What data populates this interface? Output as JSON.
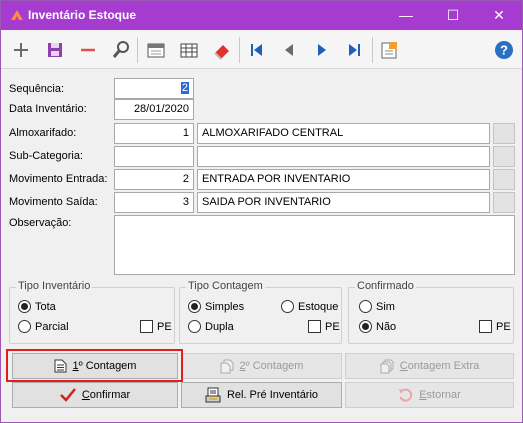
{
  "window": {
    "title": "Inventário Estoque",
    "minimize": "—",
    "maximize": "☐",
    "close": "✕"
  },
  "toolbar": {
    "icons": [
      "add-icon",
      "save-icon",
      "remove-icon",
      "search-icon",
      "export-icon",
      "grid-icon",
      "eraser-icon",
      "first-icon",
      "prev-icon",
      "next-icon",
      "last-icon",
      "report-icon",
      "help-icon"
    ]
  },
  "form": {
    "sequencia": {
      "label": "Sequência:",
      "value": "2"
    },
    "data_inventario": {
      "label": "Data Inventário:",
      "value": "28/01/2020"
    },
    "almoxarifado": {
      "label": "Almoxarifado:",
      "code": "1",
      "desc": "ALMOXARIFADO CENTRAL"
    },
    "subcategoria": {
      "label": "Sub-Categoria:",
      "code": "",
      "desc": ""
    },
    "mov_entrada": {
      "label": "Movimento Entrada:",
      "code": "2",
      "desc": "ENTRADA POR INVENTARIO"
    },
    "mov_saida": {
      "label": "Movimento Saída:",
      "code": "3",
      "desc": "SAIDA POR INVENTARIO"
    },
    "observacao": {
      "label": "Observação:",
      "value": ""
    }
  },
  "groups": {
    "tipo_inventario": {
      "title": "Tipo Inventário",
      "opt1": "Tota",
      "opt2": "Parcial",
      "pe": "PE",
      "selected": "Tota"
    },
    "tipo_contagem": {
      "title": "Tipo Contagem",
      "opt1": "Simples",
      "opt2": "Dupla",
      "opt3": "Estoque",
      "pe": "PE",
      "selected": "Simples"
    },
    "confirmado": {
      "title": "Confirmado",
      "opt1": "Sim",
      "opt2": "Não",
      "pe": "PE",
      "selected": "Não"
    }
  },
  "buttons": {
    "contagem1": {
      "mn": "1",
      "rest": "º Contagem"
    },
    "contagem2": {
      "mn": "2",
      "rest": "º Contagem"
    },
    "contagem_extra": {
      "mn": "C",
      "rest": "ontagem Extra"
    },
    "confirmar": {
      "mn": "C",
      "rest": "onfirmar"
    },
    "rel_pre": {
      "text": "Rel. Pré Inventário"
    },
    "estornar": {
      "mn": "E",
      "rest": "stornar"
    }
  }
}
